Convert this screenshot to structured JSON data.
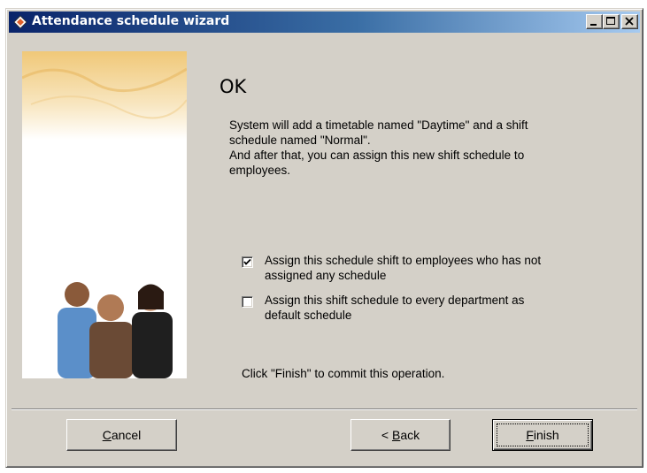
{
  "window": {
    "title": "Attendance schedule wizard",
    "icon": "wizard-diamond-icon"
  },
  "titlebar_buttons": {
    "minimize_icon": "minimize-icon",
    "maximize_icon": "maximize-icon",
    "close_icon": "close-icon"
  },
  "content": {
    "heading": "OK",
    "description_lines": [
      "System will add a timetable named \"Daytime\" and a shift",
      "schedule named \"Normal\".",
      "And after that, you can assign this new shift schedule to",
      "employees."
    ],
    "options": [
      {
        "checked": true,
        "label_lines": [
          "Assign this schedule shift to employees who has not",
          "assigned any schedule"
        ]
      },
      {
        "checked": false,
        "label_lines": [
          "Assign this shift schedule to every department as",
          "default schedule"
        ]
      }
    ],
    "footer_note": "Click \"Finish\" to commit this operation."
  },
  "buttons": {
    "cancel": {
      "mnemonic": "C",
      "rest": "ancel"
    },
    "back": {
      "prefix": "< ",
      "mnemonic": "B",
      "rest": "ack"
    },
    "finish": {
      "mnemonic": "F",
      "rest": "inish"
    }
  },
  "colors": {
    "title_gradient_start": "#0a246a",
    "title_gradient_end": "#a6caf0",
    "dialog_face": "#d4d0c8"
  }
}
